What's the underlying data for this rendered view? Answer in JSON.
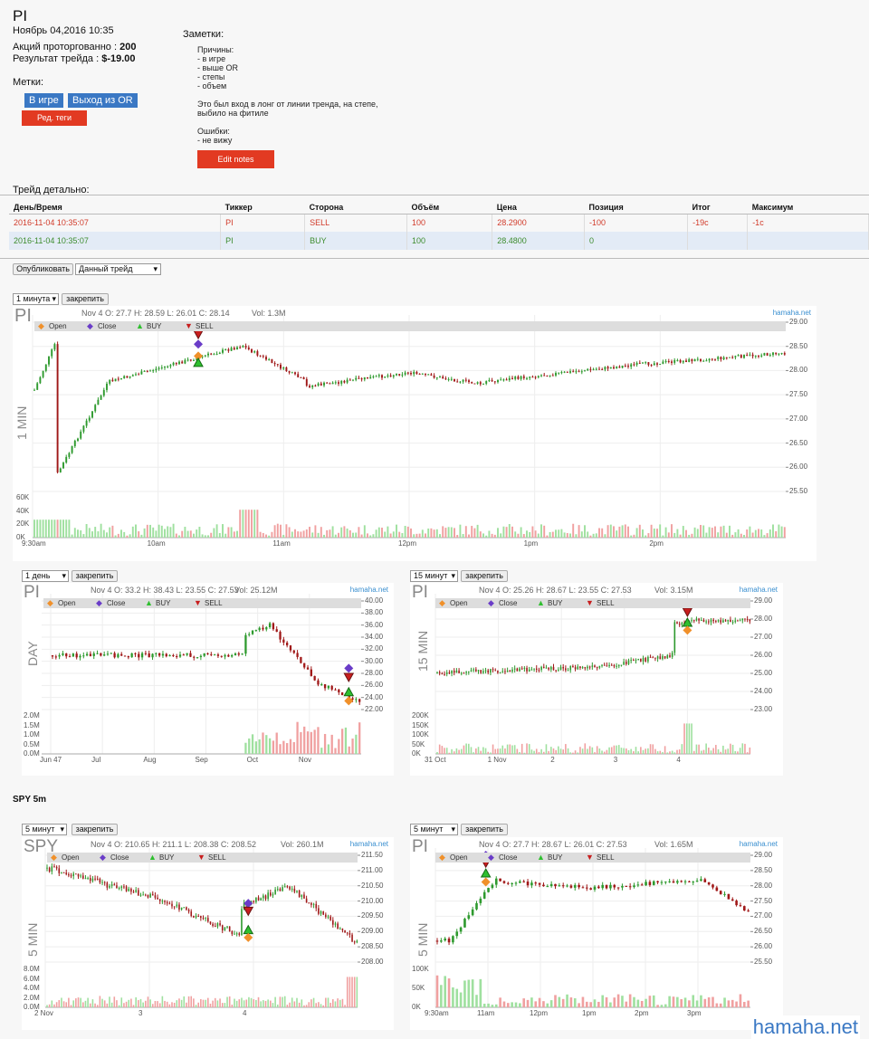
{
  "header": {
    "ticker": "PI",
    "datetime": "Ноябрь 04,2016 10:35",
    "shares_label": "Акций проторгованно :",
    "shares_value": "200",
    "result_label": "Результат трейда :",
    "result_value": "$-19.00",
    "tags_label": "Метки:",
    "tags": [
      "В игре",
      "Выход из OR"
    ],
    "edit_tags_label": "Ред. теги"
  },
  "notes": {
    "label": "Заметки:",
    "lines": [
      "Причины:",
      "- в игре",
      "- выше OR",
      "- степы",
      "- объем",
      "",
      "Это был вход в лонг от линии тренда, на степе,",
      "выбило на фитиле",
      "",
      "Ошибки:",
      "- не вижу"
    ],
    "edit_label": "Edit notes"
  },
  "trade_detail": {
    "label": "Трейд детально:",
    "columns": [
      "День/Время",
      "Тиккер",
      "Сторона",
      "Объём",
      "Цена",
      "Позиция",
      "Итог",
      "Максимум"
    ],
    "rows": [
      [
        "2016-11-04 10:35:07",
        "PI",
        "SELL",
        "100",
        "28.2900",
        "-100",
        "-19c",
        "-1c"
      ],
      [
        "2016-11-04 10:35:07",
        "PI",
        "BUY",
        "100",
        "28.4800",
        "0",
        "",
        ""
      ]
    ]
  },
  "publish": {
    "button": "Опубликовать",
    "select": "Данный трейд"
  },
  "legend": {
    "open": "Open",
    "close": "Close",
    "buy": "BUY",
    "sell": "SELL"
  },
  "colors": {
    "up": "#2e9a2e",
    "down": "#a01818",
    "vol_up": "#9fe09f",
    "vol_down": "#f0a0a0",
    "buy": "#2fbf2f",
    "sell": "#c81e1e",
    "open": "#f0902a",
    "close": "#6a3cc8"
  },
  "charts": {
    "pin_label": "закрепить",
    "c1": {
      "select": "1 минута",
      "ticker": "PI",
      "ohlc": "Nov 4 O: 27.7 H: 28.59 L: 26.01 C: 28.14",
      "vol": "Vol: 1.3M",
      "src": "hamaha.net",
      "period": "1 MIN",
      "yticks": [
        "29.00",
        "28.50",
        "28.00",
        "27.50",
        "27.00",
        "26.50",
        "26.00",
        "25.50"
      ],
      "vticks": [
        "60K",
        "40K",
        "20K",
        "0K"
      ],
      "xticks": [
        "9:30am",
        "10am",
        "11am",
        "12pm",
        "1pm",
        "2pm"
      ]
    },
    "c2": {
      "select": "1 день",
      "ticker": "PI",
      "ohlc": "Nov 4 O: 33.2 H: 38.43 L: 23.55 C: 27.53",
      "vol": "Vol: 25.12M",
      "src": "hamaha.net",
      "period": "DAY",
      "yticks": [
        "40.00",
        "38.00",
        "36.00",
        "34.00",
        "32.00",
        "30.00",
        "28.00",
        "26.00",
        "24.00",
        "22.00"
      ],
      "vticks": [
        "2.0M",
        "1.5M",
        "1.0M",
        "0.5M",
        "0.0M"
      ],
      "xticks": [
        "Jun 47",
        "Jul",
        "Aug",
        "Sep",
        "Oct",
        "Nov"
      ]
    },
    "c3": {
      "select": "15 минут",
      "ticker": "PI",
      "ohlc": "Nov 4 O: 25.26 H: 28.67 L: 23.55 C: 27.53",
      "vol": "Vol: 3.15M",
      "src": "hamaha.net",
      "period": "15 MIN",
      "yticks": [
        "29.00",
        "28.00",
        "27.00",
        "26.00",
        "25.00",
        "24.00",
        "23.00"
      ],
      "vticks": [
        "200K",
        "150K",
        "100K",
        "50K",
        "0K"
      ],
      "xticks": [
        "31 Oct",
        "1 Nov",
        "2",
        "3",
        "4"
      ]
    },
    "spy_label": "SPY 5m",
    "c4": {
      "select": "5 минут",
      "ticker": "SPY",
      "ohlc": "Nov 4 O: 210.65 H: 211.1 L: 208.38 C: 208.52",
      "vol": "Vol: 260.1M",
      "src": "hamaha.net",
      "period": "5 MIN",
      "yticks": [
        "211.50",
        "211.00",
        "210.50",
        "210.00",
        "209.50",
        "209.00",
        "208.50",
        "208.00"
      ],
      "vticks": [
        "8.0M",
        "6.0M",
        "4.0M",
        "2.0M",
        "0.0M"
      ],
      "xticks": [
        "2 Nov",
        "3",
        "4"
      ]
    },
    "c5": {
      "select": "5 минут",
      "ticker": "PI",
      "ohlc": "Nov 4 O: 27.7 H: 28.67 L: 26.01 C: 27.53",
      "vol": "Vol: 1.65M",
      "src": "hamaha.net",
      "period": "5 MIN",
      "yticks": [
        "29.00",
        "28.50",
        "28.00",
        "27.50",
        "27.00",
        "26.50",
        "26.00",
        "25.50"
      ],
      "vticks": [
        "100K",
        "50K",
        "0K"
      ],
      "xticks": [
        "9:30am",
        "11am",
        "12pm",
        "1pm",
        "2pm",
        "3pm"
      ]
    }
  },
  "watermark": "hamaha.net"
}
